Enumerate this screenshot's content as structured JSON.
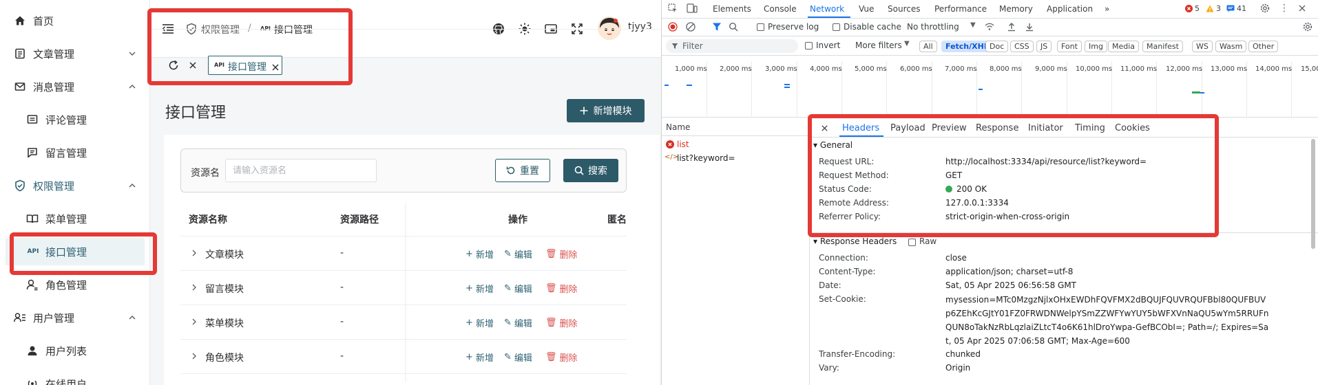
{
  "sidebar": {
    "items": [
      {
        "label": "首页",
        "icon": "home-icon"
      },
      {
        "label": "文章管理",
        "icon": "article-icon"
      },
      {
        "label": "消息管理",
        "icon": "mail-icon"
      },
      {
        "label": "评论管理",
        "icon": "comment-icon"
      },
      {
        "label": "留言管理",
        "icon": "message-icon"
      },
      {
        "label": "权限管理",
        "icon": "shield-check-icon"
      },
      {
        "label": "菜单管理",
        "icon": "book-icon"
      },
      {
        "label": "接口管理",
        "icon": "api-icon"
      },
      {
        "label": "角色管理",
        "icon": "user-role-icon"
      },
      {
        "label": "用户管理",
        "icon": "users-icon"
      },
      {
        "label": "用户列表",
        "icon": "user-icon"
      },
      {
        "label": "在线用户",
        "icon": "broadcast-icon"
      }
    ]
  },
  "header": {
    "breadcrumb": {
      "parent": "权限管理",
      "current": "接口管理",
      "api_glyph": "API"
    },
    "username": "tjyy3",
    "tag": {
      "label": "接口管理",
      "api_glyph": "API"
    }
  },
  "main": {
    "title": "接口管理",
    "add_button": "新增模块",
    "filter": {
      "label": "资源名",
      "placeholder": "请输入资源名",
      "reset": "重置",
      "search": "搜索"
    },
    "table": {
      "headers": [
        "资源名称",
        "资源路径",
        "操作",
        "匿名"
      ],
      "rows": [
        {
          "name": "文章模块",
          "path": "-"
        },
        {
          "name": "留言模块",
          "path": "-"
        },
        {
          "name": "菜单模块",
          "path": "-"
        },
        {
          "name": "角色模块",
          "path": "-"
        }
      ],
      "actions": {
        "add": "新增",
        "edit": "编辑",
        "delete": "删除"
      }
    }
  },
  "devtools": {
    "tabs": [
      "Elements",
      "Console",
      "Network",
      "Vue",
      "Sources",
      "Performance",
      "Memory",
      "Application"
    ],
    "active_tab": "Network",
    "errors": "5",
    "warnings": "3",
    "messages": "41",
    "toolbar": {
      "preserve_log": "Preserve log",
      "disable_cache": "Disable cache",
      "throttling": "No throttling"
    },
    "filter": {
      "placeholder": "Filter",
      "invert": "Invert",
      "more_filters": "More filters",
      "types": [
        "All",
        "Fetch/XHR",
        "Doc",
        "CSS",
        "JS",
        "Font",
        "Img",
        "Media",
        "Manifest",
        "WS",
        "Wasm",
        "Other"
      ],
      "active_type": "Fetch/XHR"
    },
    "timeline": {
      "ticks": [
        "1,000 ms",
        "2,000 ms",
        "3,000 ms",
        "4,000 ms",
        "5,000 ms",
        "6,000 ms",
        "7,000 ms",
        "8,000 ms",
        "9,000 ms",
        "10,000 ms",
        "11,000 ms",
        "12,000 ms",
        "13,000 ms",
        "14,000 ms",
        "15,00"
      ]
    },
    "name_header": "Name",
    "requests": [
      {
        "name": "list",
        "status": "error"
      },
      {
        "name": "list?keyword=",
        "status": "selected"
      }
    ],
    "detail": {
      "tabs": [
        "Headers",
        "Payload",
        "Preview",
        "Response",
        "Initiator",
        "Timing",
        "Cookies"
      ],
      "active_tab": "Headers",
      "general_title": "General",
      "general": [
        {
          "key": "Request URL:",
          "value": "http://localhost:3334/api/resource/list?keyword="
        },
        {
          "key": "Request Method:",
          "value": "GET"
        },
        {
          "key": "Status Code:",
          "value": "200 OK"
        },
        {
          "key": "Remote Address:",
          "value": "127.0.0.1:3334"
        },
        {
          "key": "Referrer Policy:",
          "value": "strict-origin-when-cross-origin"
        }
      ],
      "response_title": "Response Headers",
      "raw_label": "Raw",
      "response": [
        {
          "key": "Connection:",
          "value": "close"
        },
        {
          "key": "Content-Type:",
          "value": "application/json; charset=utf-8"
        },
        {
          "key": "Date:",
          "value": "Sat, 05 Apr 2025 06:56:58 GMT"
        },
        {
          "key": "Set-Cookie:",
          "value": "mysession=MTc0MzgzNjlxOHxEWDhFQVFMX2dBQUJFQUVRQUFBbl80QUFBUVp6ZEhKcGJtY01FZ0FRWDNWelpYSmZZWFYwYUY5bWFXVnNaQU5wYm5RRUFnQUN8oTakNzRbLqzlaiZLtcT4o6K61hlDroYwpa-GefBCObI=; Path=/; Expires=Sat, 05 Apr 2025 07:06:58 GMT; Max-Age=600"
        },
        {
          "key": "Transfer-Encoding:",
          "value": "chunked"
        },
        {
          "key": "Vary:",
          "value": "Origin"
        }
      ]
    }
  }
}
